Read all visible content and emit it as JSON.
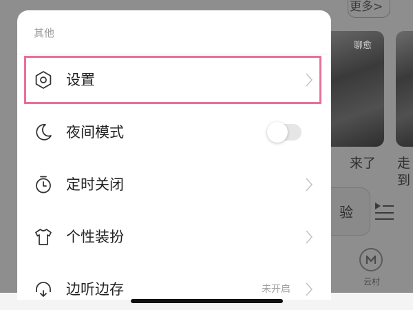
{
  "background": {
    "more_label": "更多>",
    "card_tag": "聊愈",
    "caption_1": "来了",
    "caption_2_line1": "走",
    "caption_2_line2": "到",
    "pill_text": "验",
    "cloud_label": "云村"
  },
  "sheet": {
    "section_title": "其他",
    "items": [
      {
        "label": "设置",
        "icon": "settings-hexagon-icon",
        "accessory": "chevron"
      },
      {
        "label": "夜间模式",
        "icon": "moon-icon",
        "accessory": "toggle",
        "toggle_on": false
      },
      {
        "label": "定时关闭",
        "icon": "timer-icon",
        "accessory": "chevron"
      },
      {
        "label": "个性装扮",
        "icon": "tshirt-icon",
        "accessory": "chevron"
      },
      {
        "label": "边听边存",
        "icon": "headphones-icon",
        "accessory": "chevron",
        "state": "未开启"
      }
    ]
  },
  "colors": {
    "highlight": "#e8709a",
    "toggle_off": "#e6e6e6"
  }
}
